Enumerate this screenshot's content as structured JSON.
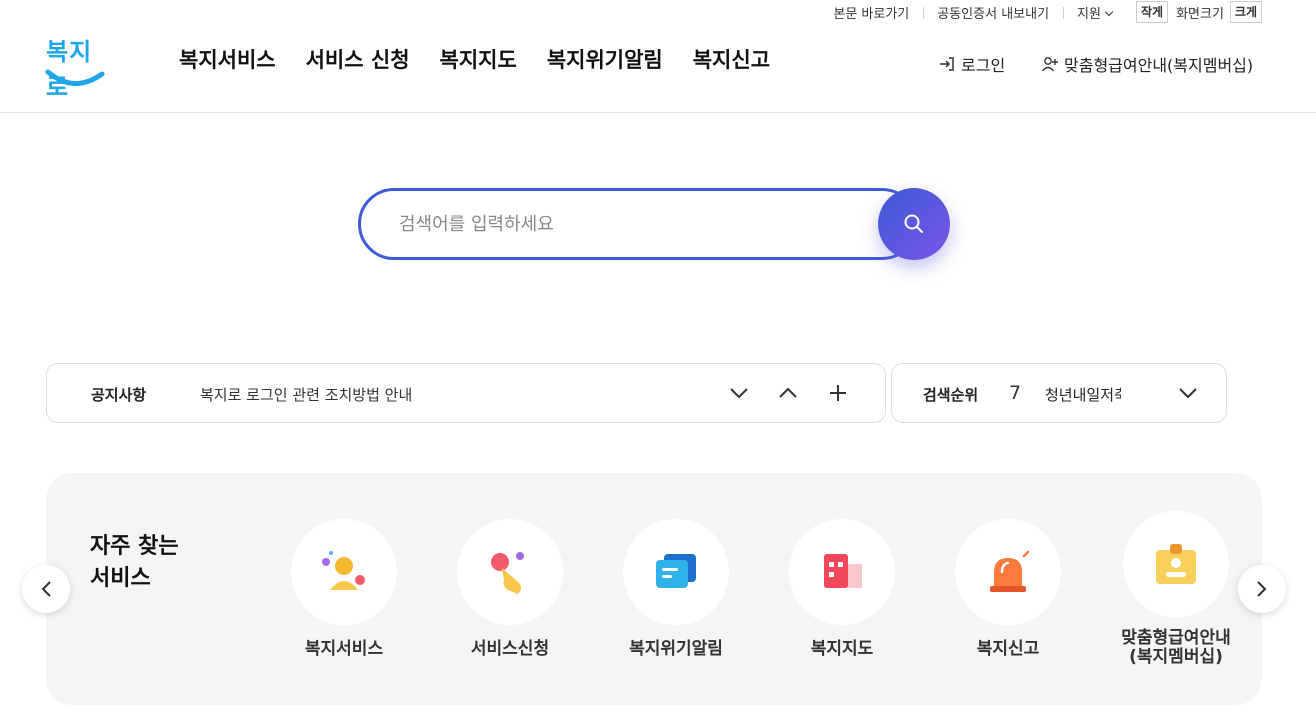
{
  "util": {
    "skip": "본문 바로가기",
    "cert": "공동인증서 내보내기",
    "support": "지원",
    "font_small": "작게",
    "font_label": "화면크기",
    "font_large": "크게"
  },
  "header": {
    "logo_text": "복지로",
    "nav": [
      "복지서비스",
      "서비스 신청",
      "복지지도",
      "복지위기알림",
      "복지신고"
    ],
    "login": "로그인",
    "member": "맞춤형급여안내(복지멤버십)"
  },
  "search": {
    "placeholder": "검색어를 입력하세요"
  },
  "notice": {
    "title": "공지사항",
    "text": "복지로 로그인 관련 조치방법 안내"
  },
  "ranking": {
    "title": "검색순위",
    "rank": "7",
    "keyword": "청년내일저축"
  },
  "frequent": {
    "title_line1": "자주 찾는",
    "title_line2": "서비스",
    "items": [
      {
        "label": "복지서비스",
        "icon": "person-icon"
      },
      {
        "label": "서비스신청",
        "icon": "hand-pointer-icon"
      },
      {
        "label": "복지위기알림",
        "icon": "chat-bubble-icon"
      },
      {
        "label": "복지지도",
        "icon": "building-map-icon"
      },
      {
        "label": "복지신고",
        "icon": "siren-icon"
      },
      {
        "label": "맞춤형급여안내\n(복지멤버십)",
        "icon": "id-badge-icon"
      }
    ]
  }
}
